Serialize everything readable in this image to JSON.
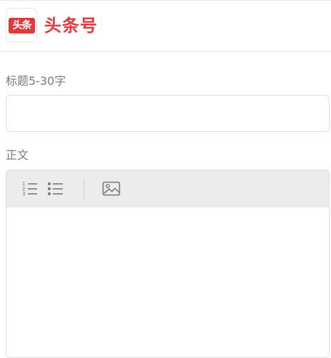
{
  "header": {
    "logo_text": "头条",
    "brand_name": "头条号"
  },
  "form": {
    "title_label": "标题5-30字",
    "title_value": "",
    "body_label": "正文",
    "body_value": ""
  },
  "toolbar": {
    "icons": [
      "ordered-list-icon",
      "unordered-list-icon",
      "image-icon"
    ]
  }
}
